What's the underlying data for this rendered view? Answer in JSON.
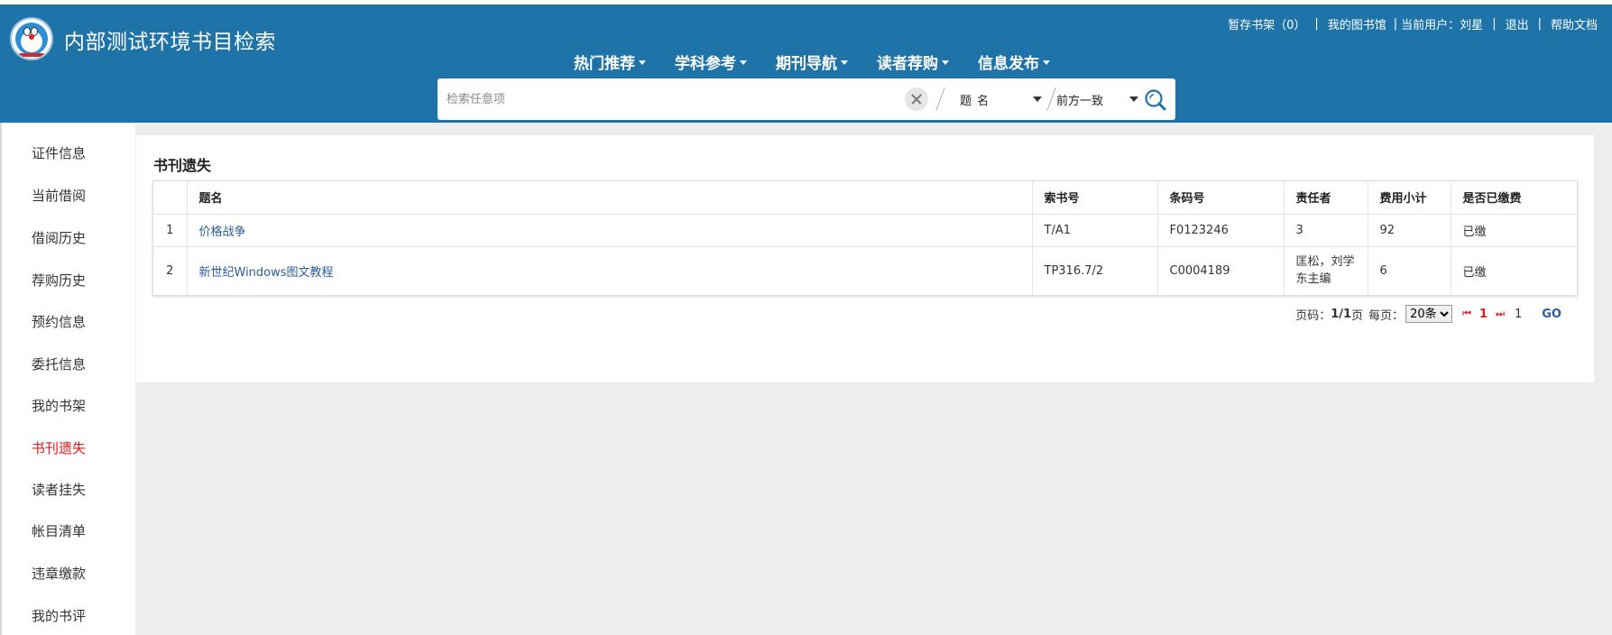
{
  "header": {
    "site_title": "内部测试环境书目检索",
    "toplinks": {
      "cart": "暂存书架（0）",
      "my_library": "我的图书馆",
      "current_user_label": "当前用户：",
      "current_user": "刘星",
      "logout": "退出",
      "help": "帮助文档"
    },
    "nav": [
      "热门推荐",
      "学科参考",
      "期刊导航",
      "读者荐购",
      "信息发布"
    ]
  },
  "search": {
    "placeholder": "检索任意项",
    "field_value": "题名",
    "match_value": "前方一致"
  },
  "sidebar": {
    "items": [
      "证件信息",
      "当前借阅",
      "借阅历史",
      "荐购历史",
      "预约信息",
      "委托信息",
      "我的书架",
      "书刊遗失",
      "读者挂失",
      "帐目清单",
      "违章缴款",
      "我的书评"
    ],
    "active": "书刊遗失"
  },
  "main": {
    "title": "书刊遗失",
    "columns": [
      "",
      "题名",
      "索书号",
      "条码号",
      "责任者",
      "费用小计",
      "是否已缴费"
    ],
    "rows": [
      {
        "idx": "1",
        "title": "价格战争",
        "call_no": "T/A1",
        "barcode": "F0123246",
        "author": "3",
        "fee": "92",
        "paid": "已缴"
      },
      {
        "idx": "2",
        "title": "新世纪Windows图文教程",
        "call_no": "TP316.7/2",
        "barcode": "C0004189",
        "author": "匡松，刘学东主编",
        "fee": "6",
        "paid": "已缴"
      }
    ]
  },
  "pager": {
    "page_label": "页码：",
    "page_value": "1/1",
    "page_suffix": "页",
    "per_page_label": "每页：",
    "per_page": "20条",
    "current": "1",
    "page_input": "1",
    "go": "GO"
  },
  "colors": {
    "header_bg": "#1e74a9",
    "active_red": "#e01b1b",
    "link_blue": "#2a5c9a"
  }
}
